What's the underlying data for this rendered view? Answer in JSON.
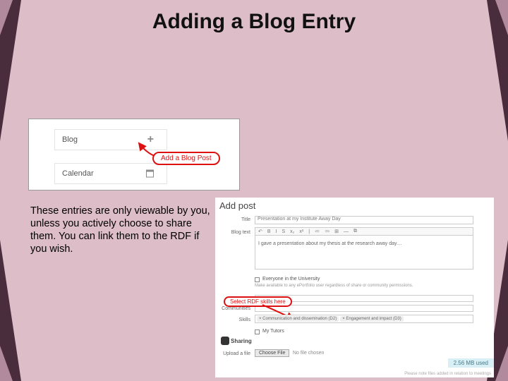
{
  "slide": {
    "title": "Adding a Blog Entry",
    "body_text": "These entries are only viewable by you, unless you actively choose to share them. You can link them to the RDF if you wish."
  },
  "left_card": {
    "blog_label": "Blog",
    "calendar_label": "Calendar",
    "plus_glyph": "+",
    "callout": "Add a Blog Post"
  },
  "right_card": {
    "panel_title": "Add post",
    "labels": {
      "title": "Title",
      "blog_text": "Blog text",
      "communities": "Communities",
      "skills": "Skills",
      "sharing": "Sharing",
      "upload": "Upload a file"
    },
    "title_value": "Presentation at my Institute Away Day",
    "toolbar_items": [
      "↶",
      "B",
      "I",
      "S",
      "x₂",
      "x²",
      "|",
      "≔",
      "≕",
      "⊞",
      "—",
      "⧉"
    ],
    "editor_text": "I gave a presentation about my thesis at the research away day…",
    "checkbox_everyone": "Everyone in the University",
    "everyone_note": "Make available to any ePortfolio user regardless of share or community permissions.",
    "callout_rdf": "Select RDF skills here",
    "skill_tags": [
      "× Communication and dissemination (D2)",
      "× Engagement and impact (D3)"
    ],
    "checkbox_tutors": "My Tutors",
    "choose_file_btn": "Choose File",
    "no_file_text": "No file chosen",
    "storage_used": "2.56 MB used",
    "footnote": "Please note files added in relation to meetings"
  }
}
